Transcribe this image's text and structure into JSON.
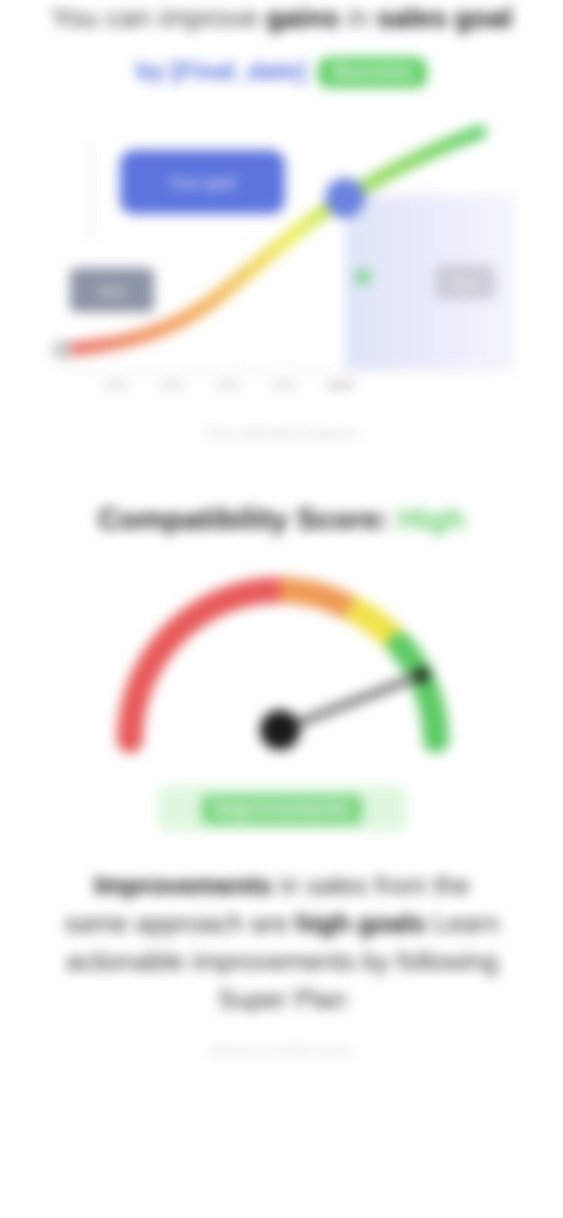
{
  "header": {
    "headline_pre": "You can improve",
    "headline_bold1": "gains",
    "headline_mid": "in",
    "headline_bold2": "sales goal",
    "date_text": "by [Final_date]",
    "badge_text": "Success"
  },
  "chart": {
    "callout_blue": "Your goal",
    "callout_gray": "Now",
    "callout_right": "Goal",
    "footnote": "Your estimated progress"
  },
  "compatibility": {
    "title": "Compatibility Score:",
    "level": "High",
    "result_label": "Improvements",
    "paragraph_bold1": "Improvements",
    "paragraph_text1": "in sales from the same approach",
    "paragraph_mid": "are ",
    "paragraph_bold2": "high goals",
    "paragraph_text2": "Learn actionable improvements by following",
    "paragraph_text3": "Super Plan",
    "footnote": "Based on similar users"
  },
  "colors": {
    "accent_blue": "#4c67dc",
    "success_green": "#62d06a",
    "danger_red": "#e85a5a",
    "warning_yellow": "#f2e24a",
    "needle": "#1a1a1a"
  }
}
